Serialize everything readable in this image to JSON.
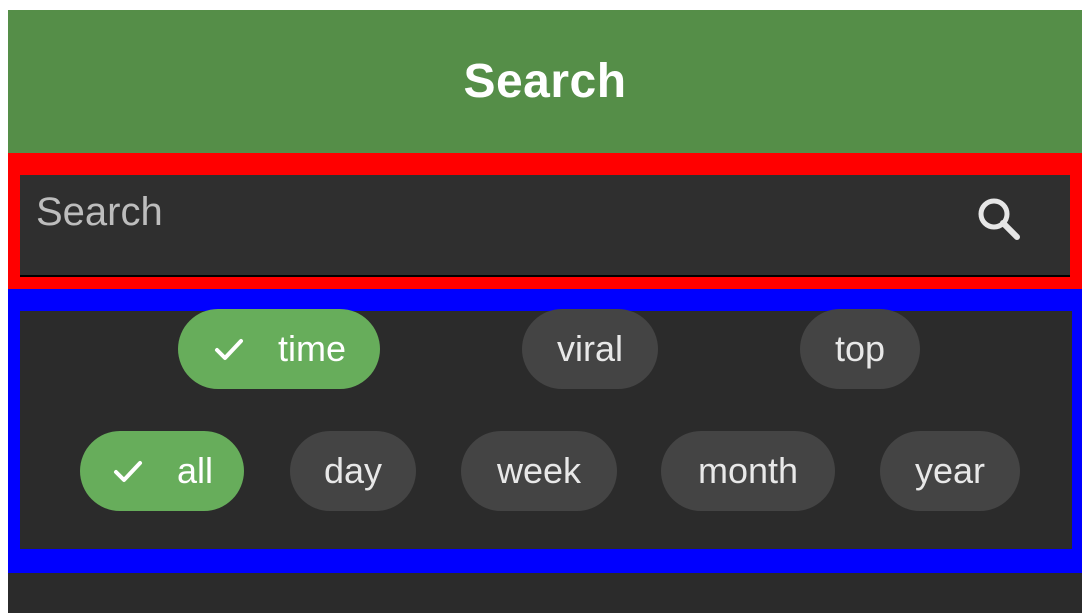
{
  "header": {
    "title": "Search"
  },
  "search": {
    "placeholder": "Search",
    "icon": "search-icon"
  },
  "sort_options": [
    {
      "label": "time",
      "selected": true
    },
    {
      "label": "viral",
      "selected": false
    },
    {
      "label": "top",
      "selected": false
    }
  ],
  "window_options": [
    {
      "label": "all",
      "selected": true
    },
    {
      "label": "day",
      "selected": false
    },
    {
      "label": "week",
      "selected": false
    },
    {
      "label": "month",
      "selected": false
    },
    {
      "label": "year",
      "selected": false
    }
  ],
  "colors": {
    "header_bg": "#558e48",
    "selected_chip": "#67ad5b",
    "chip": "#444444",
    "highlight_search": "#ff0000",
    "highlight_filters": "#0000ff"
  }
}
